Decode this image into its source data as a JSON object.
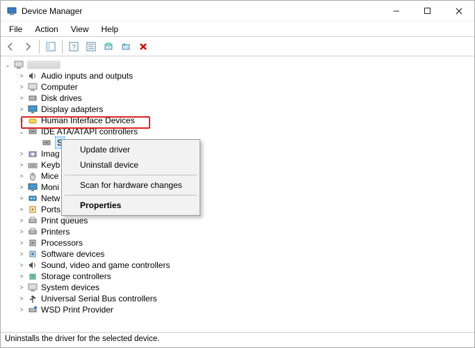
{
  "window": {
    "title": "Device Manager"
  },
  "menus": {
    "file": "File",
    "action": "Action",
    "view": "View",
    "help": "Help"
  },
  "root_label": "",
  "categories": [
    {
      "id": "audio",
      "label": "Audio inputs and outputs",
      "expanded": false
    },
    {
      "id": "computer",
      "label": "Computer",
      "expanded": false
    },
    {
      "id": "diskdrives",
      "label": "Disk drives",
      "expanded": false
    },
    {
      "id": "display",
      "label": "Display adapters",
      "expanded": false
    },
    {
      "id": "hid",
      "label": "Human Interface Devices",
      "expanded": false
    },
    {
      "id": "ide",
      "label": "IDE ATA/ATAPI controllers",
      "expanded": true,
      "highlight_red": true
    },
    {
      "id": "imaging",
      "label": "Imag",
      "expanded": false
    },
    {
      "id": "keyboards",
      "label": "Keyb",
      "expanded": false
    },
    {
      "id": "mice",
      "label": "Mice",
      "expanded": false
    },
    {
      "id": "monitors",
      "label": "Moni",
      "expanded": false
    },
    {
      "id": "network",
      "label": "Netw",
      "expanded": false
    },
    {
      "id": "ports",
      "label": "Ports (COM & LPT)",
      "expanded": false
    },
    {
      "id": "printqueues",
      "label": "Print queues",
      "expanded": false
    },
    {
      "id": "printers",
      "label": "Printers",
      "expanded": false
    },
    {
      "id": "processors",
      "label": "Processors",
      "expanded": false
    },
    {
      "id": "software",
      "label": "Software devices",
      "expanded": false
    },
    {
      "id": "sound",
      "label": "Sound, video and game controllers",
      "expanded": false
    },
    {
      "id": "storage",
      "label": "Storage controllers",
      "expanded": false
    },
    {
      "id": "system",
      "label": "System devices",
      "expanded": false
    },
    {
      "id": "usb",
      "label": "Universal Serial Bus controllers",
      "expanded": false
    },
    {
      "id": "wsd",
      "label": "WSD Print Provider",
      "expanded": false
    }
  ],
  "ide_child_selected": true,
  "context_menu": {
    "items": [
      {
        "label": "Update driver",
        "bold": false
      },
      {
        "label": "Uninstall device",
        "bold": false
      },
      {
        "sep": true
      },
      {
        "label": "Scan for hardware changes",
        "bold": false
      },
      {
        "sep": true
      },
      {
        "label": "Properties",
        "bold": true
      }
    ]
  },
  "status": "Uninstalls the driver for the selected device."
}
